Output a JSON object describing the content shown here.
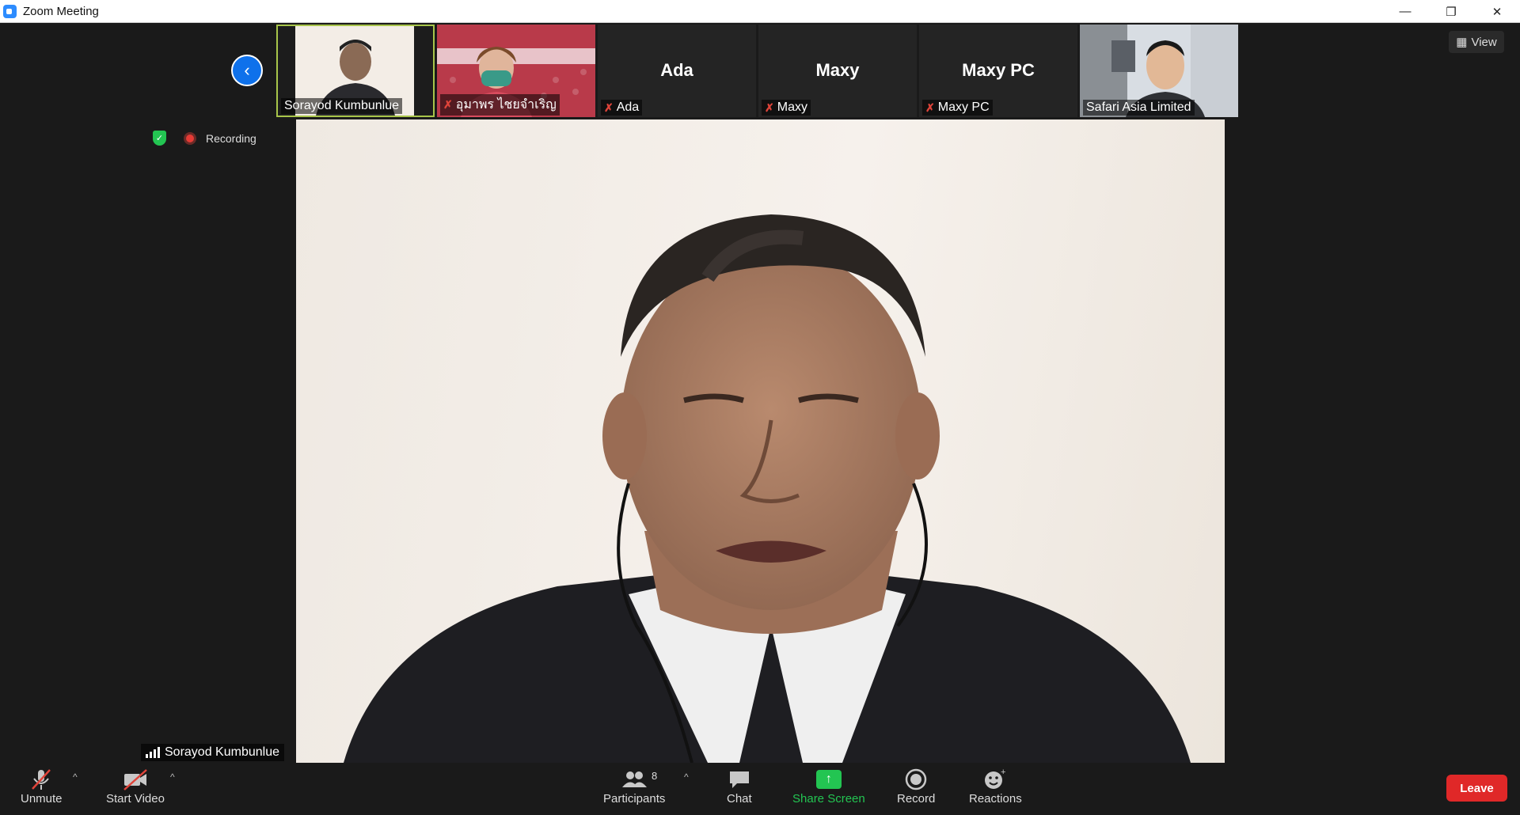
{
  "window": {
    "title": "Zoom Meeting"
  },
  "thumbnails": [
    {
      "label": "Sorayod Kumbunlue",
      "muted": false,
      "has_video": true,
      "active": true
    },
    {
      "label": "อุมาพร ไชยจำเริญ",
      "muted": true,
      "has_video": true,
      "active": false
    },
    {
      "label": "Ada",
      "big_name": "Ada",
      "muted": true,
      "has_video": false,
      "active": false
    },
    {
      "label": "Maxy",
      "big_name": "Maxy",
      "muted": true,
      "has_video": false,
      "active": false
    },
    {
      "label": "Maxy PC",
      "big_name": "Maxy PC",
      "muted": true,
      "has_video": false,
      "active": false
    },
    {
      "label": "Safari Asia Limited",
      "muted": false,
      "has_video": true,
      "active": false
    }
  ],
  "view_button": "View",
  "status": {
    "recording": "Recording"
  },
  "speaker": {
    "name": "Sorayod Kumbunlue"
  },
  "toolbar": {
    "unmute": "Unmute",
    "start_video": "Start Video",
    "participants": "Participants",
    "participants_count": "8",
    "chat": "Chat",
    "share_screen": "Share Screen",
    "record": "Record",
    "reactions": "Reactions",
    "leave": "Leave"
  },
  "colors": {
    "accent_blue": "#0e71eb",
    "share_green": "#23c552",
    "leave_red": "#e02828",
    "active_border": "#a8c54a"
  }
}
